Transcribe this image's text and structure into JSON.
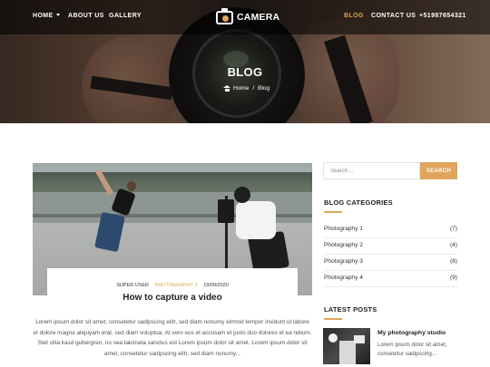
{
  "nav": {
    "left_links": [
      {
        "label": "HOME",
        "has_dropdown": true
      },
      {
        "label": "ABOUT US"
      },
      {
        "label": "GALLERY"
      }
    ],
    "logo_text": "CAMERA",
    "right_links": [
      {
        "label": "BLOG",
        "active": true
      },
      {
        "label": "CONTACT US"
      },
      {
        "label": "+51987654321"
      }
    ]
  },
  "hero": {
    "title": "BLOG",
    "breadcrumb": {
      "home": "Home",
      "separator": "/",
      "current": "Blog"
    }
  },
  "post": {
    "author": "SUPER USER",
    "category": "PHOTOGRAPHY 2",
    "date": "19/09/2020",
    "title": "How to capture a video",
    "excerpt": "Lorem ipsum dolor sit amet, consetetur sadipscing elitr, sed diam nonumy eirmod tempor invidunt ut labore et dolore magna aliquyam erat, sed diam voluptua. At vero eos et accusam et justo duo dolores et ea rebum. Stet clita kasd gubergren, no sea takimata sanctus est Lorem ipsum dolor sit amet. Lorem ipsum dolor sit amet, consetetur sadipscing elitr, sed diam nonumy..."
  },
  "sidebar": {
    "search": {
      "placeholder": "Search ...",
      "value": "",
      "button_label": "SEARCH"
    },
    "categories_title": "BLOG CATEGORIES",
    "categories": [
      {
        "name": "Photography 1",
        "count": "(7)"
      },
      {
        "name": "Photography 2",
        "count": "(4)"
      },
      {
        "name": "Photography 3",
        "count": "(8)"
      },
      {
        "name": "Photography 4",
        "count": "(9)"
      }
    ],
    "latest_title": "LATEST POSTS",
    "latest_posts": [
      {
        "title": "My photography studio",
        "excerpt": "Lorem ipsum dolor sit amet, consetetur sadipscing..."
      }
    ]
  },
  "colors": {
    "accent": "#e0a45c",
    "nav_overlay": "#000000",
    "text_dark": "#222222",
    "text_body": "#555555"
  },
  "icons": {
    "breadcrumb_home": "home-icon",
    "logo": "camera-logo-icon",
    "home_dropdown": "chevron-down-icon"
  }
}
